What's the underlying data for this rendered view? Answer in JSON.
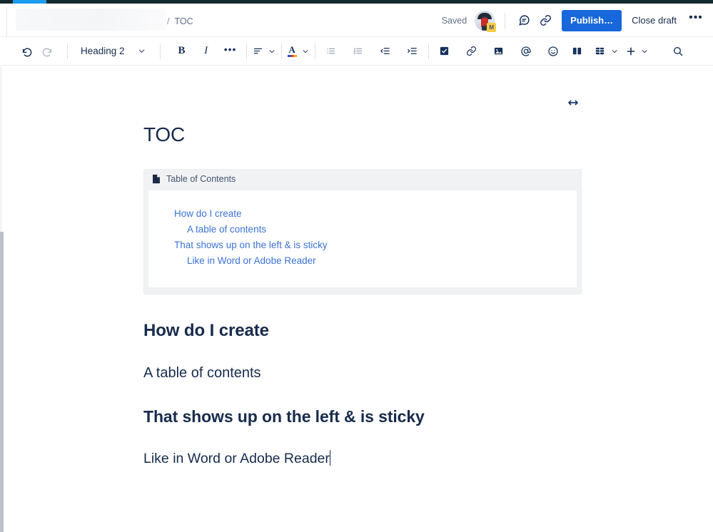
{
  "app": {
    "accent_blue": "#1868db",
    "toc_link_color": "#3b73d4",
    "text_color": "#172b4d",
    "macro_bg": "#f1f2f4",
    "top_strip_color": "#14292e",
    "top_strip_active_color": "#1a9cf0"
  },
  "header": {
    "title_placeholder": "",
    "breadcrumb_separator": "/",
    "breadcrumb_crumb": "TOC",
    "saved_label": "Saved",
    "avatar_badge": "M",
    "comment_icon": "comment-icon",
    "link_icon": "link-icon",
    "publish_label": "Publish…",
    "close_draft_label": "Close draft",
    "more_label": "•••"
  },
  "toolbar": {
    "undo_icon": "undo-icon",
    "redo_icon": "redo-icon",
    "style_label": "Heading 2",
    "style_chevron": "⌄",
    "bold_label": "B",
    "italic_label": "I",
    "more_formatting_label": "•••",
    "align_icon": "text-align-icon",
    "text_color_label": "A",
    "bullet_list_icon": "bullet-list-icon",
    "numbered_list_icon": "numbered-list-icon",
    "outdent_icon": "outdent-icon",
    "indent_icon": "indent-icon",
    "task_icon": "task-checkbox-icon",
    "link_icon": "link-icon",
    "image_icon": "image-icon",
    "mention_icon": "mention-icon",
    "emoji_icon": "emoji-icon",
    "layout_icon": "layout-columns-icon",
    "table_icon": "table-icon",
    "insert_icon": "plus-icon",
    "find_icon": "search-icon"
  },
  "canvas": {
    "width_toggle_icon": "horizontal-resize-icon"
  },
  "document": {
    "title": "TOC",
    "toc_macro": {
      "header_icon": "page-icon",
      "header_label": "Table of Contents",
      "entries": [
        {
          "text": "How do I create",
          "level": 1
        },
        {
          "text": "A table of contents",
          "level": 2
        },
        {
          "text": "That shows up on the left & is sticky",
          "level": 1
        },
        {
          "text": "Like in Word or Adobe Reader",
          "level": 2
        }
      ]
    },
    "blocks": [
      {
        "text": "How do I create",
        "style": "h1"
      },
      {
        "text": "A table of contents",
        "style": "h2"
      },
      {
        "text": "That shows up on the left & is sticky",
        "style": "h1"
      },
      {
        "text": "Like in Word or Adobe Reader",
        "style": "h2",
        "caret": true
      }
    ]
  }
}
